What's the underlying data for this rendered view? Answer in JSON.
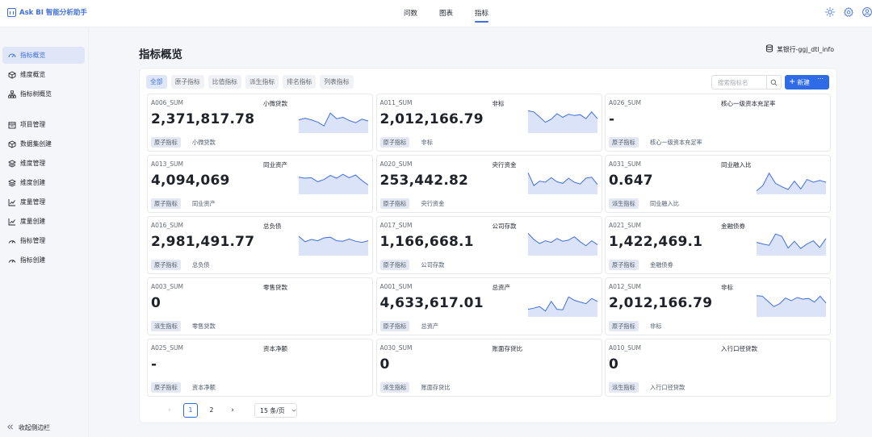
{
  "app": {
    "title": "Ask BI 智能分析助手"
  },
  "topnav": [
    {
      "label": "问数"
    },
    {
      "label": "图表"
    },
    {
      "label": "指标"
    }
  ],
  "sidebar": {
    "items": [
      {
        "label": "指标概览",
        "icon": "dashboard-icon"
      },
      {
        "label": "维度概览",
        "icon": "cube-icon"
      },
      {
        "label": "指标树概览",
        "icon": "tree-icon"
      },
      {
        "label": "项目管理",
        "icon": "calendar-icon"
      },
      {
        "label": "数据集创建",
        "icon": "dataset-icon"
      },
      {
        "label": "维度管理",
        "icon": "layers-icon"
      },
      {
        "label": "维度创建",
        "icon": "layers-plus-icon"
      },
      {
        "label": "度量管理",
        "icon": "chart-icon"
      },
      {
        "label": "度量创建",
        "icon": "chart-plus-icon"
      },
      {
        "label": "指标管理",
        "icon": "gauge-icon"
      },
      {
        "label": "指标创建",
        "icon": "gauge-plus-icon"
      }
    ],
    "collapse_label": "收起侧边栏"
  },
  "page": {
    "title": "指标概览",
    "datasource": "某银行-ggj_dtl_info"
  },
  "filters": [
    "全部",
    "原子指标",
    "比值指标",
    "派生指标",
    "排名指标",
    "列表指标"
  ],
  "search": {
    "placeholder": "搜索指标名"
  },
  "new_button": {
    "label": "新建"
  },
  "metrics": [
    {
      "code": "A006_SUM",
      "name": "小微贷款",
      "value": "2,371,817.78",
      "tag": "原子指标",
      "desc": "小微贷款",
      "trend": [
        0.55,
        0.62,
        0.55,
        0.45,
        0.28,
        0.85,
        0.6,
        0.66,
        0.52,
        0.42,
        0.58,
        0.5
      ]
    },
    {
      "code": "A011_SUM",
      "name": "非标",
      "value": "2,012,166.79",
      "tag": "原子指标",
      "desc": "非标",
      "trend": [
        0.95,
        0.9,
        0.68,
        0.44,
        0.58,
        0.82,
        0.66,
        0.8,
        0.74,
        0.78,
        0.6,
        0.9,
        0.6
      ]
    },
    {
      "code": "A026_SUM",
      "name": "核心一级资本充足率",
      "value": "-",
      "tag": "原子指标",
      "desc": "核心一级资本充足率",
      "trend": []
    },
    {
      "code": "A013_SUM",
      "name": "同业资产",
      "value": "4,094,069",
      "tag": "原子指标",
      "desc": "同业资产",
      "trend": [
        0.72,
        0.68,
        0.7,
        0.52,
        0.62,
        0.8,
        0.68,
        0.85,
        0.7,
        0.82,
        0.58,
        0.38
      ]
    },
    {
      "code": "A020_SUM",
      "name": "央行资金",
      "value": "253,442.82",
      "tag": "原子指标",
      "desc": "央行资金",
      "trend": [
        0.92,
        0.35,
        0.55,
        0.5,
        0.7,
        0.52,
        0.45,
        0.68,
        0.5,
        0.42,
        0.68,
        0.72,
        0.4
      ]
    },
    {
      "code": "A031_SUM",
      "name": "同业融入比",
      "value": "0.647",
      "tag": "派生指标",
      "desc": "同业融入比",
      "trend": [
        0.12,
        0.35,
        0.9,
        0.45,
        0.3,
        0.18,
        0.55,
        0.2,
        0.62,
        0.5,
        0.58,
        0.5
      ]
    },
    {
      "code": "A016_SUM",
      "name": "总负债",
      "value": "2,981,491.77",
      "tag": "原子指标",
      "desc": "总负债",
      "trend": [
        0.82,
        0.58,
        0.68,
        0.62,
        0.75,
        0.78,
        0.62,
        0.6,
        0.7,
        0.6,
        0.55,
        0.62
      ]
    },
    {
      "code": "A017_SUM",
      "name": "公司存款",
      "value": "1,166,668.1",
      "tag": "原子指标",
      "desc": "公司存款",
      "trend": [
        0.95,
        0.68,
        0.5,
        0.62,
        0.55,
        0.72,
        0.6,
        0.65,
        0.8,
        0.58,
        0.4,
        0.62,
        0.45
      ]
    },
    {
      "code": "A021_SUM",
      "name": "金融债券",
      "value": "1,422,469.1",
      "tag": "原子指标",
      "desc": "金融债券",
      "trend": [
        0.55,
        0.48,
        0.42,
        0.92,
        0.82,
        0.3,
        0.6,
        0.28,
        0.48,
        0.62,
        0.32,
        0.72
      ]
    },
    {
      "code": "A003_SUM",
      "name": "零售贷款",
      "value": "0",
      "tag": "派生指标",
      "desc": "零售贷款",
      "trend": []
    },
    {
      "code": "A001_SUM",
      "name": "总资产",
      "value": "4,633,617.01",
      "tag": "原子指标",
      "desc": "总资产",
      "trend": [
        0.3,
        0.35,
        0.42,
        0.22,
        0.65,
        0.3,
        0.28,
        0.85,
        0.7,
        0.62,
        0.55,
        0.78,
        0.65
      ]
    },
    {
      "code": "A012_SUM",
      "name": "非标",
      "value": "2,012,166.79",
      "tag": "原子指标",
      "desc": "非标",
      "trend": [
        0.9,
        0.88,
        0.65,
        0.42,
        0.55,
        0.8,
        0.68,
        0.82,
        0.75,
        0.78,
        0.62,
        0.88,
        0.58
      ]
    },
    {
      "code": "A025_SUM",
      "name": "资本净额",
      "value": "-",
      "tag": "原子指标",
      "desc": "资本净额",
      "trend": []
    },
    {
      "code": "A030_SUM",
      "name": "账面存贷比",
      "value": "0",
      "tag": "派生指标",
      "desc": "账面存贷比",
      "trend": []
    },
    {
      "code": "A010_SUM",
      "name": "入行口径贷款",
      "value": "0",
      "tag": "派生指标",
      "desc": "入行口径贷款",
      "trend": []
    }
  ],
  "pagination": {
    "pages": [
      "1",
      "2"
    ],
    "current": "1",
    "page_size": "15 条/页"
  },
  "colors": {
    "accent": "#2f6be6",
    "spark_line": "#3f6fe0",
    "spark_fill": "#dbe3f8"
  }
}
